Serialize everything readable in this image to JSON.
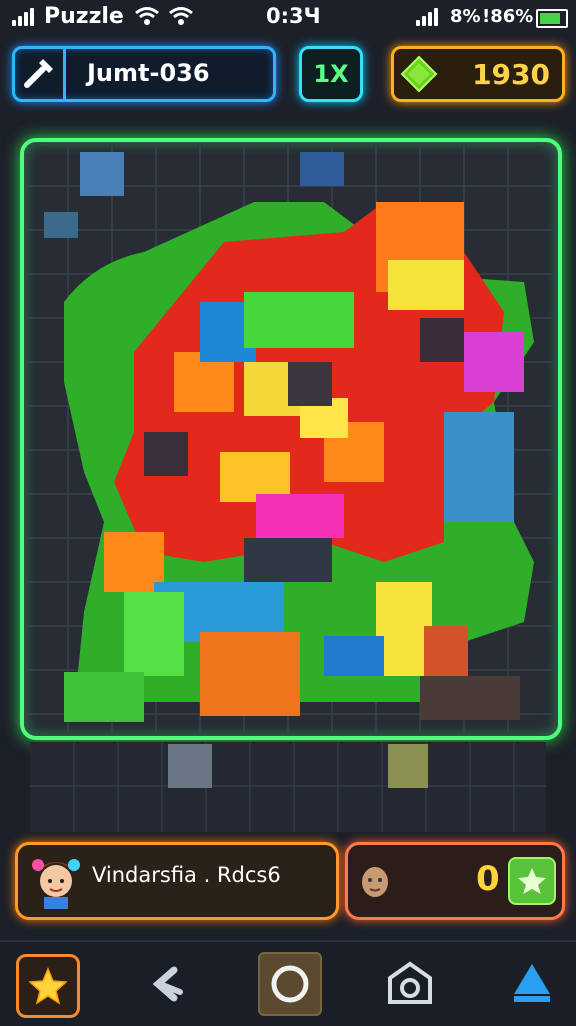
{
  "status_bar": {
    "app_name": "Puzzle",
    "time": "0:3Ч",
    "battery_percent_a": "8%",
    "battery_percent_b": "!86%"
  },
  "hud": {
    "level_label": "Jumt-036",
    "multiplier": "1X",
    "gems": "1930"
  },
  "player": {
    "name": "Vindarsfia . Rdcs6",
    "score": "0"
  },
  "colors": {
    "accent_green": "#4dff7a",
    "accent_blue": "#2fb6ff",
    "accent_gold": "#ffb020"
  },
  "nav": {
    "items": [
      "star-icon",
      "back-arrow-icon",
      "circle-button-icon",
      "camera-icon",
      "up-triangle-icon"
    ]
  }
}
